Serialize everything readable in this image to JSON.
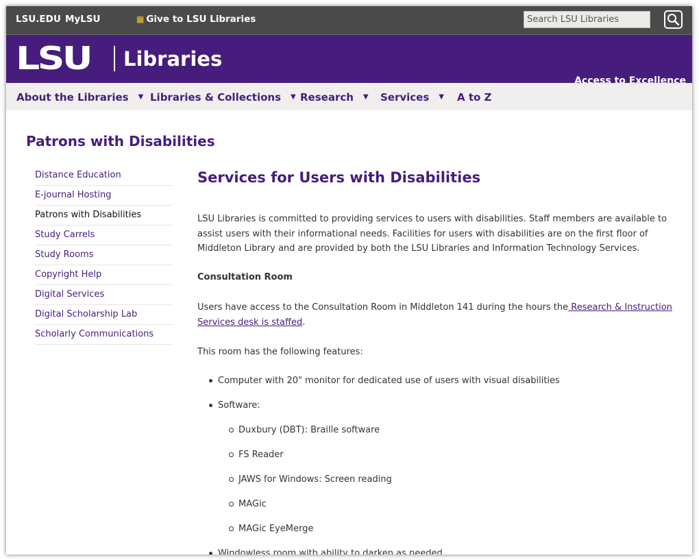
{
  "topbar": {
    "lsu_edu": "LSU.EDU",
    "mylsu": "MyLSU",
    "give": "Give to LSU Libraries",
    "search_placeholder": "Search LSU Libraries"
  },
  "banner": {
    "logo": "LSU",
    "libraries": "Libraries",
    "tagline": "Access to Excellence"
  },
  "nav": {
    "items": [
      {
        "label": "About the Libraries",
        "has_dropdown": true
      },
      {
        "label": "Libraries & Collections",
        "has_dropdown": true
      },
      {
        "label": "Research",
        "has_dropdown": true
      },
      {
        "label": "Services",
        "has_dropdown": true
      },
      {
        "label": "A to Z",
        "has_dropdown": false
      }
    ]
  },
  "section_title": "Patrons with Disabilities",
  "sidebar": {
    "items": [
      {
        "label": "Distance Education"
      },
      {
        "label": "E-journal Hosting"
      },
      {
        "label": "Patrons with Disabilities",
        "active": true
      },
      {
        "label": "Study Carrels"
      },
      {
        "label": "Study Rooms"
      },
      {
        "label": "Copyright Help"
      },
      {
        "label": "Digital Services"
      },
      {
        "label": "Digital Scholarship Lab"
      },
      {
        "label": "Scholarly Communications"
      }
    ]
  },
  "main": {
    "title": "Services for Users with Disabilities",
    "intro": "LSU Libraries is committed to providing services to users with disabilities.  Staff members are available to assist users with their informational needs. Facilities for users with disabilities are on the first floor of Middleton Library and are provided by both the LSU Libraries and Information Technology Services.",
    "consultation_heading": "Consultation Room",
    "access_text": "Users have access to the Consultation Room in Middleton 141 during the hours the",
    "access_link": " Research & Instruction Services desk is staffed",
    "access_end": ".",
    "features_intro": "This room has the following features:",
    "features": [
      "Computer with 20\" monitor for dedicated use of users with visual disabilities",
      "Software:",
      "Windowless room with ability to darken as needed"
    ],
    "software": [
      "Duxbury (DBT): Braille software",
      "FS Reader",
      "JAWS for Windows: Screen reading",
      "MAGic",
      "MAGic EyeMerge"
    ]
  },
  "colors": {
    "brand_purple": "#461d7c",
    "topbar_gray": "#4a4a4a",
    "nav_bg": "#f0efee",
    "gift_gold": "#f2c230"
  }
}
